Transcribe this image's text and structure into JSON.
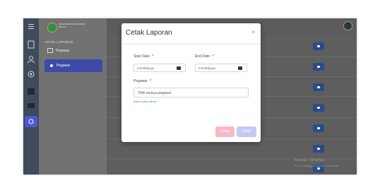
{
  "sidebar": {
    "brand_line1": "BALAI PEMASYARAKATAN",
    "brand_line2": "KELAS I",
    "section_label": "CETAK LAPORAN",
    "items": [
      {
        "label": "Pegawai"
      },
      {
        "label": "Pegawai",
        "active": true
      }
    ]
  },
  "modal": {
    "title": "Cetak Laporan",
    "close_symbol": "×",
    "start_label": "Start Date : *",
    "end_label": "End Date : *",
    "start_placeholder": "mm/dd/yyyy",
    "end_placeholder": "mm/dd/yyyy",
    "pegawai_label": "Pegawai : *",
    "pegawai_value": "Pilih semua pegawai",
    "link_text": "Batal ceklis pilihan",
    "close_button": "Close",
    "print_button": "Cetak"
  },
  "watermark": {
    "line1": "Activate Windows",
    "line2": "Go to Settings to activate Windows."
  },
  "colors": {
    "sidebar_active": "#3d4aa8",
    "action_button": "#2b4a8c",
    "close_button": "#f6b9c6",
    "print_button": "#c7c8f3"
  }
}
